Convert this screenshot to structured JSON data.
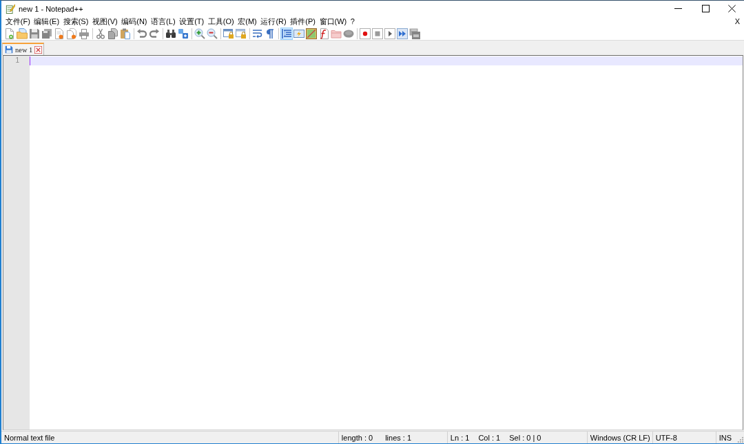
{
  "window": {
    "title": "new 1 - Notepad++"
  },
  "menu_bar": {
    "items": [
      "文件(F)",
      "编辑(E)",
      "搜索(S)",
      "视图(V)",
      "编码(N)",
      "语言(L)",
      "设置(T)",
      "工具(O)",
      "宏(M)",
      "运行(R)",
      "插件(P)",
      "窗口(W)",
      "?"
    ],
    "close_document": "X"
  },
  "toolbar": {
    "groups": [
      {
        "buttons": [
          {
            "kind": "new",
            "selected": false
          },
          {
            "kind": "open",
            "selected": false
          },
          {
            "kind": "save",
            "selected": false
          },
          {
            "kind": "saveall",
            "selected": false
          },
          {
            "kind": "close",
            "selected": false
          },
          {
            "kind": "closeall",
            "selected": false
          },
          {
            "kind": "print",
            "selected": false
          }
        ]
      },
      {
        "buttons": [
          {
            "kind": "cut",
            "selected": false
          },
          {
            "kind": "copy",
            "selected": false
          },
          {
            "kind": "paste",
            "selected": false
          }
        ]
      },
      {
        "buttons": [
          {
            "kind": "undo",
            "selected": false
          },
          {
            "kind": "redo",
            "selected": false
          }
        ]
      },
      {
        "buttons": [
          {
            "kind": "find",
            "selected": false
          },
          {
            "kind": "replace",
            "selected": false
          }
        ]
      },
      {
        "buttons": [
          {
            "kind": "zoomin",
            "selected": false
          },
          {
            "kind": "zoomout",
            "selected": false
          }
        ]
      },
      {
        "buttons": [
          {
            "kind": "syncv",
            "selected": false
          },
          {
            "kind": "synch",
            "selected": false
          }
        ]
      },
      {
        "buttons": [
          {
            "kind": "wrap",
            "selected": false
          },
          {
            "kind": "allchars",
            "selected": false
          }
        ]
      },
      {
        "buttons": [
          {
            "kind": "indent",
            "selected": true
          },
          {
            "kind": "udl",
            "selected": false
          },
          {
            "kind": "docmap",
            "selected": false
          },
          {
            "kind": "funclist",
            "selected": false
          },
          {
            "kind": "folder",
            "selected": false
          },
          {
            "kind": "monitor",
            "selected": false
          }
        ]
      },
      {
        "buttons": [
          {
            "kind": "record",
            "selected": false
          },
          {
            "kind": "stop",
            "selected": false
          },
          {
            "kind": "play",
            "selected": false
          },
          {
            "kind": "playmulti",
            "selected": false
          },
          {
            "kind": "savemacro",
            "selected": false
          }
        ]
      }
    ]
  },
  "tabs": [
    {
      "label": "new 1",
      "selected": true
    }
  ],
  "editor": {
    "line_numbers": [
      "1"
    ]
  },
  "status_bar": {
    "sections": [
      {
        "texts": [
          "Normal text file"
        ]
      },
      {
        "texts": [
          "length : 0",
          "lines : 1"
        ]
      },
      {
        "texts": [
          "Ln : 1",
          "Col : 1",
          "Sel : 0 | 0"
        ]
      },
      {
        "texts": [
          "Windows (CR LF)"
        ]
      },
      {
        "texts": [
          "UTF-8"
        ]
      },
      {
        "texts": [
          "INS"
        ]
      }
    ]
  }
}
